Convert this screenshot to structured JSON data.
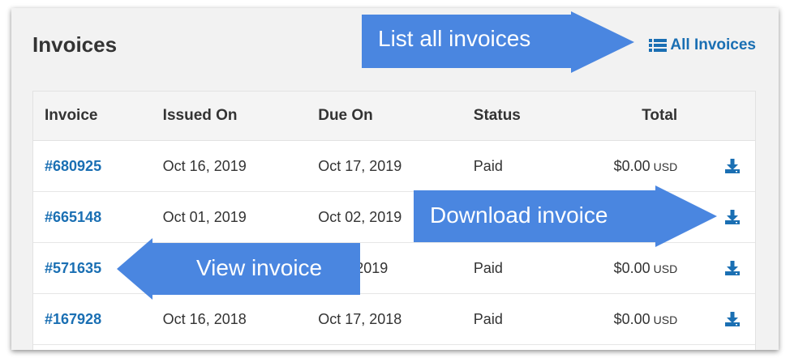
{
  "header": {
    "title": "Invoices",
    "all_invoices_label": "All Invoices"
  },
  "table": {
    "columns": [
      "Invoice",
      "Issued On",
      "Due On",
      "Status",
      "Total"
    ],
    "rows": [
      {
        "invoice": "#680925",
        "issued": "Oct 16, 2019",
        "due": "Oct 17, 2019",
        "status": "Paid",
        "amount": "$0.00",
        "currency": "USD"
      },
      {
        "invoice": "#665148",
        "issued": "Oct 01, 2019",
        "due": "Oct 02, 2019",
        "status": "",
        "amount": "",
        "currency": ""
      },
      {
        "invoice": "#571635",
        "issued": "",
        "due": "2, 2019",
        "status": "Paid",
        "amount": "$0.00",
        "currency": "USD"
      },
      {
        "invoice": "#167928",
        "issued": "Oct 16, 2018",
        "due": "Oct 17, 2018",
        "status": "Paid",
        "amount": "$0.00",
        "currency": "USD"
      }
    ]
  },
  "callouts": {
    "list_all": "List all invoices",
    "download": "Download invoice",
    "view": "View invoice"
  },
  "icons": {
    "all_invoices": "list-icon",
    "download": "download-icon"
  },
  "colors": {
    "link": "#1a6fb3",
    "callout": "#4a86e0",
    "panel": "#f2f2f2"
  }
}
